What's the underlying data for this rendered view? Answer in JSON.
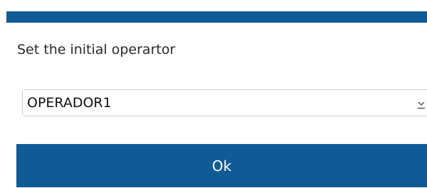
{
  "dialog": {
    "prompt": "Set the initial operartor",
    "operator_select": {
      "selected": "OPERADOR1"
    },
    "ok_label": "Ok"
  },
  "colors": {
    "accent": "#0f5b95",
    "background": "#ffffff"
  },
  "icons": {
    "dropdown": "chevron-down-icon"
  }
}
